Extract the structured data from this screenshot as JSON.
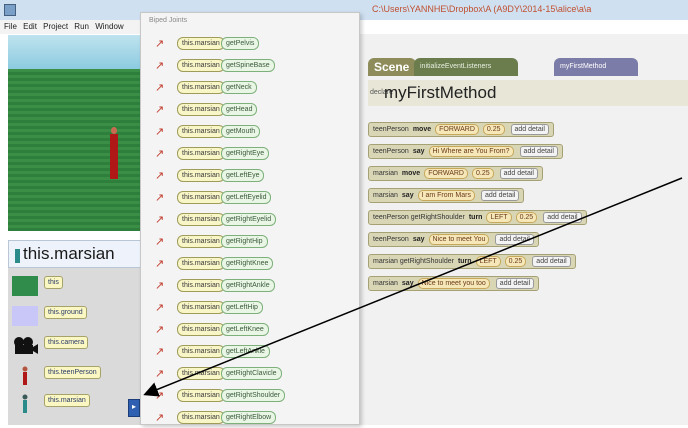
{
  "titlebar": {
    "path": "C:\\Users\\YANNHE\\Dropbox\\A (A9DY\\2014-15\\alice\\a\\a"
  },
  "menubar": {
    "items": [
      "File",
      "Edit",
      "Project",
      "Run",
      "Window"
    ]
  },
  "tree": {
    "selected": "this.marsian",
    "items": [
      {
        "label": "this",
        "thumb": "scene-thumb"
      },
      {
        "label": "this.ground",
        "thumb": "ground-thumb"
      },
      {
        "label": "this.camera",
        "thumb": "camera-thumb"
      },
      {
        "label": "this.teenPerson",
        "thumb": "person-thumb"
      },
      {
        "label": "this.marsian",
        "thumb": "marsian-thumb"
      }
    ]
  },
  "popup": {
    "header": "Biped Joints",
    "object_chip": "this.marsian",
    "methods": [
      "getPelvis",
      "getSpineBase",
      "getNeck",
      "getHead",
      "getMouth",
      "getRightEye",
      "getLeftEye",
      "getLeftEyelid",
      "getRightEyelid",
      "getRightHip",
      "getRightKnee",
      "getRightAnkle",
      "getLeftHip",
      "getLeftKnee",
      "getLeftAnkle",
      "getRightClavicle",
      "getRightShoulder",
      "getRightElbow"
    ]
  },
  "editor": {
    "tabs": [
      "Scene",
      "initializeEventListeners",
      "myFirstMethod"
    ],
    "method_keyword": "declare",
    "method_name": "myFirstMethod",
    "lines": [
      {
        "target": "teenPerson",
        "verb": "move",
        "args": [
          "FORWARD",
          "0.25"
        ],
        "detail": "add detail"
      },
      {
        "target": "teenPerson",
        "verb": "say",
        "args": [
          "Hi Where are You From?"
        ],
        "detail": "add detail"
      },
      {
        "target": "marsian",
        "verb": "move",
        "args": [
          "FORWARD",
          "0.25"
        ],
        "detail": "add detail"
      },
      {
        "target": "marsian",
        "verb": "say",
        "args": [
          "I am From Mars"
        ],
        "detail": "add detail"
      },
      {
        "target": "teenPerson getRightShoulder",
        "verb": "turn",
        "args": [
          "LEFT",
          "0.25"
        ],
        "detail": "add detail"
      },
      {
        "target": "teenPerson",
        "verb": "say",
        "args": [
          "Nice to meet You"
        ],
        "detail": "add detail"
      },
      {
        "target": "marsian getRightShoulder",
        "verb": "turn",
        "args": [
          "LEFT",
          "0.25"
        ],
        "detail": "add detail"
      },
      {
        "target": "marsian",
        "verb": "say",
        "args": [
          "Nice to meet you too"
        ],
        "detail": "add detail"
      }
    ]
  },
  "colors": {
    "accent": "#2f5fb0",
    "grass": "#3a8e46",
    "chip": "#f8f5c7"
  }
}
